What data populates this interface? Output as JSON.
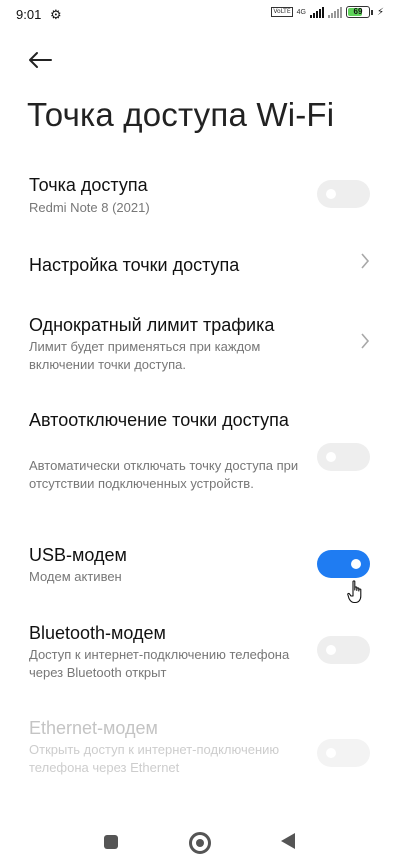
{
  "status_bar": {
    "time": "9:01",
    "network": "4G",
    "volte": "VoLTE",
    "battery": "69",
    "battery_fraction": 0.69
  },
  "header": {
    "title": "Точка доступа Wi-Fi"
  },
  "rows": {
    "hotspot": {
      "title": "Точка доступа",
      "subtitle": "Redmi Note 8 (2021)",
      "state": "off"
    },
    "hotspot_settings": {
      "title": "Настройка точки доступа"
    },
    "data_limit": {
      "title": "Однократный лимит трафика",
      "subtitle": "Лимит будет применяться при каждом включении точки доступа."
    },
    "auto_off": {
      "title": "Автоотключение точки доступа",
      "subtitle": "Автоматически отключать точку доступа при отсутствии подключенных устройств.",
      "state": "off"
    },
    "usb": {
      "title": "USB-модем",
      "subtitle": "Модем активен",
      "state": "on"
    },
    "bluetooth": {
      "title": "Bluetooth-модем",
      "subtitle": "Доступ к интернет-подключению телефона через Bluetooth открыт",
      "state": "off"
    },
    "ethernet": {
      "title": "Ethernet-модем",
      "subtitle": "Открыть доступ к интернет-подключению телефона через Ethernet",
      "state": "disabled"
    }
  },
  "colors": {
    "accent": "#1f7cf2",
    "toggle_off": "#eeeeee",
    "battery": "#5fd35a"
  }
}
